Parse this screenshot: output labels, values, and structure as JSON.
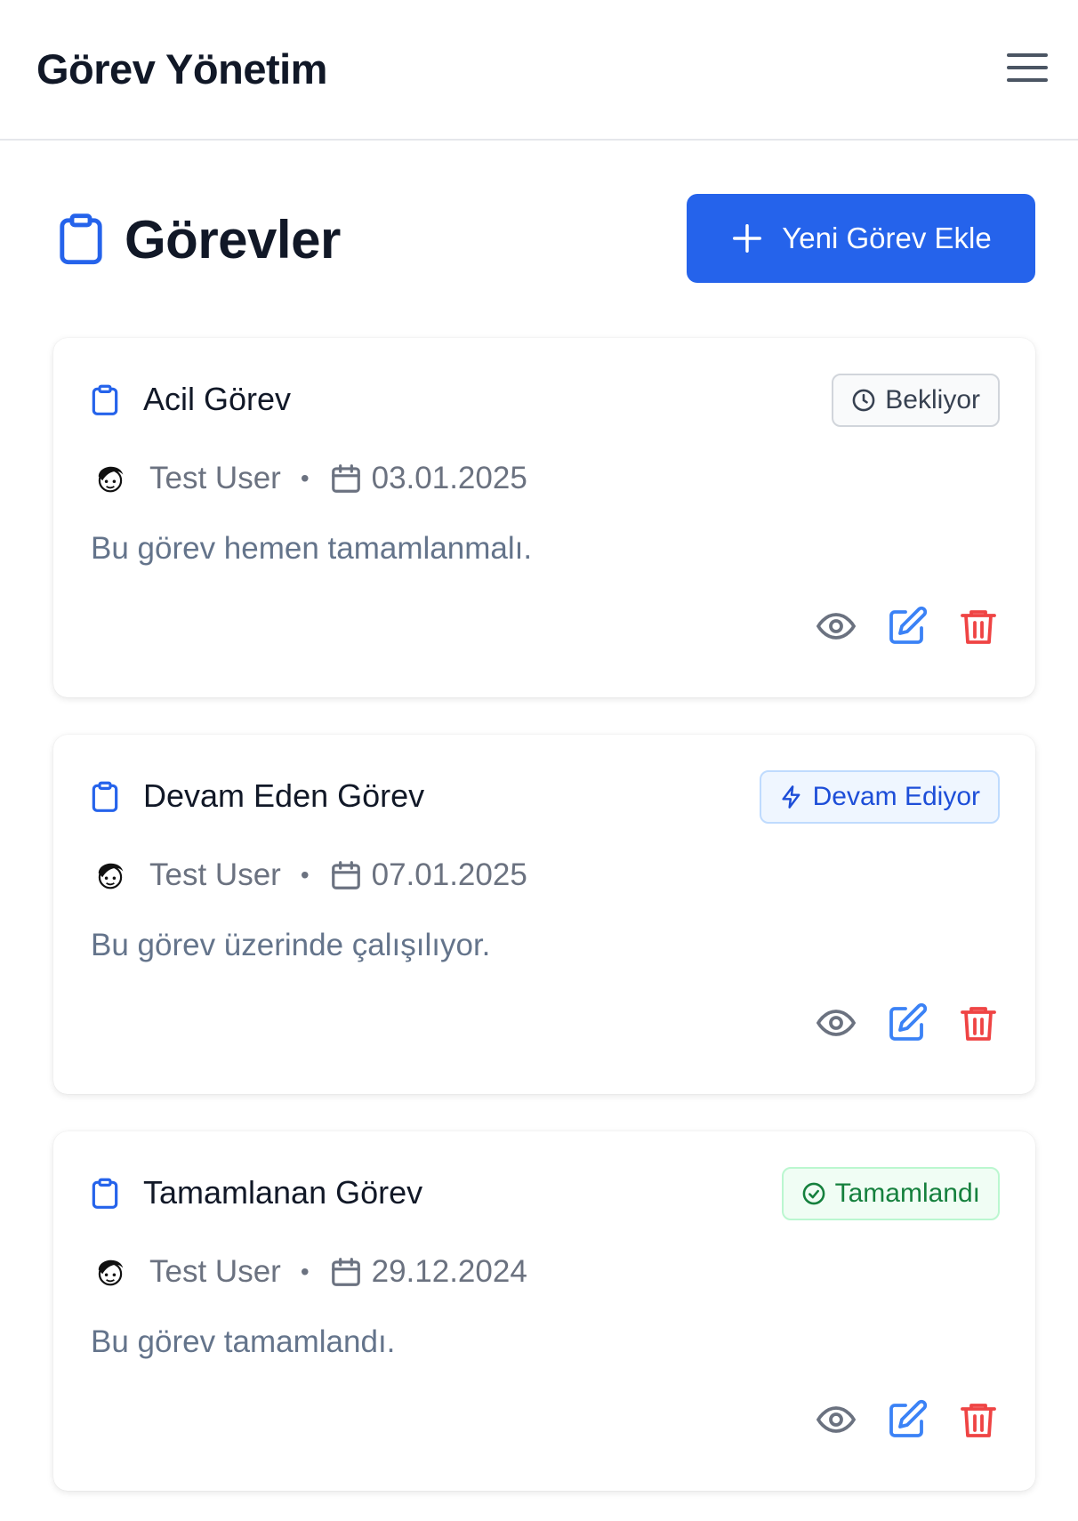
{
  "app": {
    "title": "Görev Yönetim",
    "menu_icon": "hamburger-menu-icon"
  },
  "page": {
    "title": "Görevler",
    "icon": "clipboard-icon",
    "add_button_label": "Yeni Görev Ekle",
    "add_button_icon": "plus-icon"
  },
  "colors": {
    "primary": "#2563eb",
    "pending_text": "#374151",
    "progress_text": "#1d4ed8",
    "done_text": "#15803d",
    "delete": "#ef4444",
    "view": "#6b7280"
  },
  "tasks": [
    {
      "title": "Acil Görev",
      "status": "Bekliyor",
      "status_icon": "clock-icon",
      "assignee": "Test User",
      "separator": "•",
      "date": "03.01.2025",
      "description": "Bu görev hemen tamamlanmalı."
    },
    {
      "title": "Devam Eden Görev",
      "status": "Devam Ediyor",
      "status_icon": "lightning-icon",
      "assignee": "Test User",
      "separator": "•",
      "date": "07.01.2025",
      "description": "Bu görev üzerinde çalışılıyor."
    },
    {
      "title": "Tamamlanan Görev",
      "status": "Tamamlandı",
      "status_icon": "check-circle-icon",
      "assignee": "Test User",
      "separator": "•",
      "date": "29.12.2024",
      "description": "Bu görev tamamlandı."
    }
  ]
}
